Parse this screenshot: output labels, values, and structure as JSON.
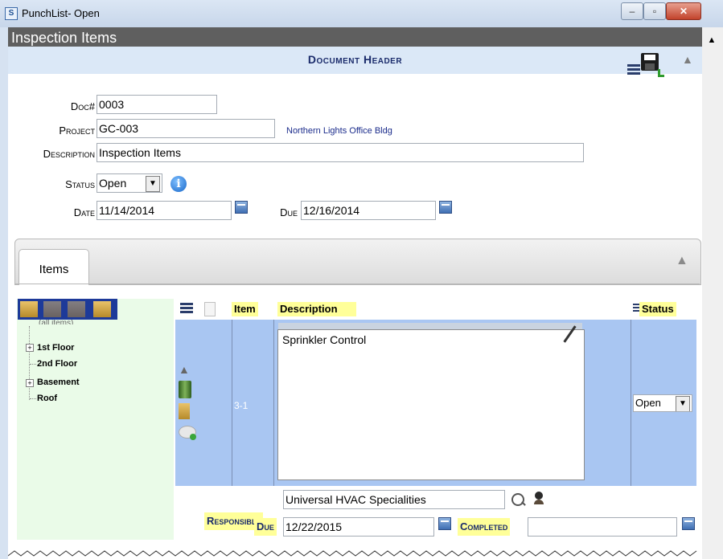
{
  "window": {
    "title": "PunchList- Open",
    "app_icon": "S"
  },
  "page": {
    "title": "Inspection Items"
  },
  "doc_header": {
    "title": "Document Header"
  },
  "form": {
    "doc_label": "Doc#",
    "doc_value": "0003",
    "project_label": "Project",
    "project_value": "GC-003",
    "project_name": "Northern Lights Office Bldg",
    "description_label": "Description",
    "description_value": "Inspection Items",
    "status_label": "Status",
    "status_value": "Open",
    "date_label": "Date",
    "date_value": "11/14/2014",
    "due_label": "Due",
    "due_value": "12/16/2014"
  },
  "items_tab": {
    "label": "Items"
  },
  "tree": {
    "partial_label": "(all items)",
    "nodes": [
      "1st Floor",
      "2nd Floor",
      "Basement",
      "Roof"
    ]
  },
  "grid": {
    "col_item": "Item",
    "col_description": "Description",
    "col_status": "Status",
    "row": {
      "item": "3-1",
      "description": "Sprinkler Control",
      "status": "Open"
    }
  },
  "detail": {
    "responsible_label": "Responsible",
    "responsible_value": "Universal HVAC Specialities",
    "due_label": "Due",
    "due_value": "12/22/2015",
    "completed_label": "Completed",
    "completed_value": ""
  },
  "icons": [
    "menu-icon",
    "save-icon",
    "collapse-icon",
    "info-icon",
    "calendar-icon",
    "trash-icon",
    "search-icon",
    "person-icon",
    "edit-icon",
    "add-comment-icon",
    "folder-icon",
    "arrow-up-icon"
  ],
  "colors": {
    "header_band": "#dbe8f7",
    "row_highlight": "#a9c6f2",
    "tree_bg": "#eafbe8",
    "label_highlight": "#ffff99",
    "title_bar_dark": "#5f5f5f"
  }
}
